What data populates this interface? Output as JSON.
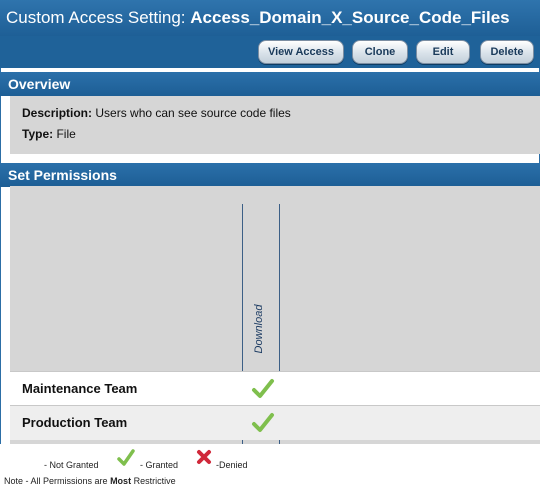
{
  "title": {
    "prefix": "Custom Access Setting:",
    "name": "Access_Domain_X_Source_Code_Files"
  },
  "toolbar": {
    "buttons": [
      "View Access",
      "Clone",
      "Edit",
      "Delete"
    ]
  },
  "overview": {
    "heading": "Overview",
    "description_label": "Description:",
    "description_value": "Users who can see source code files",
    "type_label": "Type:",
    "type_value": "File"
  },
  "permissions": {
    "heading": "Set Permissions",
    "column": "Download",
    "rows": [
      {
        "label": "Maintenance Team",
        "status": "granted"
      },
      {
        "label": "Production Team",
        "status": "granted"
      }
    ]
  },
  "legend": {
    "not_granted": "- Not Granted",
    "granted": "- Granted",
    "denied": "-Denied",
    "note_prefix": "Note - All Permissions are",
    "note_bold": "Most",
    "note_suffix": "Restrictive"
  },
  "colors": {
    "header_blue": "#1f6299",
    "panel_gray": "#d6d6d6",
    "granted_green": "#7fbf4d",
    "denied_red": "#d0283a"
  }
}
